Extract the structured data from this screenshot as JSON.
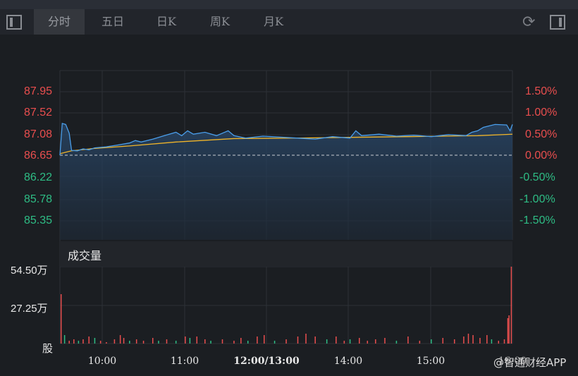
{
  "toolbar": {
    "tabs": [
      "分时",
      "五日",
      "日K",
      "周K",
      "月K"
    ],
    "active": 0,
    "left_icon": "panel-left-icon",
    "refresh_icon": "refresh-icon",
    "right_icon": "panel-right-icon"
  },
  "price_axis": {
    "labels": [
      "87.95",
      "87.52",
      "87.08",
      "86.65",
      "86.22",
      "85.78",
      "85.35"
    ],
    "pct_labels": [
      "1.50%",
      "1.00%",
      "0.50%",
      "0.00%",
      "-0.50%",
      "-1.00%",
      "-1.50%"
    ]
  },
  "volume": {
    "title": "成交量",
    "labels": [
      "54.50万",
      "27.25万"
    ],
    "unit": "股"
  },
  "time_labels": [
    "10:00",
    "11:00",
    "12:00/13:00",
    "14:00",
    "15:00",
    "16:00"
  ],
  "watermark": "@智通财经APP",
  "colors": {
    "price_line": "#4a9eea",
    "avg_line": "#f0b429",
    "up": "#e94e4e",
    "down": "#2ebd85"
  },
  "chart_data": {
    "type": "line",
    "prev_close": 86.65,
    "ylim": [
      85.2,
      88.1
    ],
    "x_minutes_range": [
      0,
      390
    ],
    "price": [
      [
        0,
        86.65
      ],
      [
        2,
        87.3
      ],
      [
        5,
        87.28
      ],
      [
        8,
        87.1
      ],
      [
        10,
        86.75
      ],
      [
        15,
        86.74
      ],
      [
        20,
        86.78
      ],
      [
        25,
        86.76
      ],
      [
        30,
        86.8
      ],
      [
        40,
        86.82
      ],
      [
        50,
        86.86
      ],
      [
        60,
        86.9
      ],
      [
        65,
        86.95
      ],
      [
        70,
        86.92
      ],
      [
        80,
        86.98
      ],
      [
        90,
        87.05
      ],
      [
        100,
        87.12
      ],
      [
        105,
        87.05
      ],
      [
        110,
        87.15
      ],
      [
        115,
        87.08
      ],
      [
        125,
        87.12
      ],
      [
        135,
        87.05
      ],
      [
        145,
        87.15
      ],
      [
        150,
        87.05
      ],
      [
        160,
        87.0
      ],
      [
        175,
        87.04
      ],
      [
        190,
        87.02
      ],
      [
        205,
        87.0
      ],
      [
        220,
        86.98
      ],
      [
        235,
        87.03
      ],
      [
        250,
        87.0
      ],
      [
        250,
        87.0
      ],
      [
        255,
        87.15
      ],
      [
        260,
        87.05
      ],
      [
        275,
        87.08
      ],
      [
        290,
        87.04
      ],
      [
        305,
        87.06
      ],
      [
        320,
        87.03
      ],
      [
        335,
        87.07
      ],
      [
        350,
        87.05
      ],
      [
        355,
        87.12
      ],
      [
        360,
        87.15
      ],
      [
        365,
        87.22
      ],
      [
        375,
        87.28
      ],
      [
        385,
        87.27
      ],
      [
        388,
        87.15
      ],
      [
        390,
        87.28
      ]
    ],
    "avg": [
      [
        0,
        86.68
      ],
      [
        10,
        86.74
      ],
      [
        30,
        86.79
      ],
      [
        60,
        86.84
      ],
      [
        100,
        86.92
      ],
      [
        150,
        86.99
      ],
      [
        200,
        87.0
      ],
      [
        300,
        87.03
      ],
      [
        360,
        87.05
      ],
      [
        390,
        87.08
      ]
    ],
    "volume_max": 54.5,
    "volume": [
      [
        1,
        35,
        1
      ],
      [
        4,
        6,
        0
      ],
      [
        8,
        2,
        1
      ],
      [
        12,
        3,
        1
      ],
      [
        16,
        2,
        0
      ],
      [
        20,
        3,
        1
      ],
      [
        25,
        5,
        1
      ],
      [
        30,
        4,
        0
      ],
      [
        35,
        2,
        1
      ],
      [
        40,
        1,
        1
      ],
      [
        47,
        3,
        1
      ],
      [
        52,
        6,
        1
      ],
      [
        55,
        4,
        1
      ],
      [
        60,
        2,
        0
      ],
      [
        66,
        3,
        1
      ],
      [
        72,
        2,
        1
      ],
      [
        80,
        4,
        1
      ],
      [
        85,
        2,
        0
      ],
      [
        92,
        3,
        1
      ],
      [
        100,
        2,
        0
      ],
      [
        108,
        5,
        1
      ],
      [
        112,
        4,
        0
      ],
      [
        118,
        5,
        1
      ],
      [
        125,
        3,
        1
      ],
      [
        130,
        2,
        0
      ],
      [
        140,
        3,
        1
      ],
      [
        150,
        2,
        1
      ],
      [
        156,
        4,
        1
      ],
      [
        162,
        2,
        0
      ],
      [
        170,
        5,
        1
      ],
      [
        176,
        6,
        1
      ],
      [
        185,
        2,
        0
      ],
      [
        195,
        3,
        1
      ],
      [
        205,
        5,
        1
      ],
      [
        212,
        7,
        1
      ],
      [
        220,
        5,
        1
      ],
      [
        230,
        3,
        0
      ],
      [
        238,
        5,
        1
      ],
      [
        245,
        2,
        1
      ],
      [
        250,
        3,
        0
      ],
      [
        258,
        4,
        1
      ],
      [
        265,
        2,
        1
      ],
      [
        272,
        3,
        1
      ],
      [
        280,
        4,
        1
      ],
      [
        290,
        2,
        0
      ],
      [
        300,
        5,
        1
      ],
      [
        310,
        2,
        1
      ],
      [
        320,
        3,
        0
      ],
      [
        330,
        4,
        1
      ],
      [
        340,
        3,
        1
      ],
      [
        348,
        5,
        1
      ],
      [
        352,
        7,
        1
      ],
      [
        356,
        6,
        1
      ],
      [
        362,
        4,
        1
      ],
      [
        368,
        6,
        1
      ],
      [
        372,
        3,
        0
      ],
      [
        378,
        2,
        1
      ],
      [
        383,
        3,
        1
      ],
      [
        386,
        18,
        1
      ],
      [
        387,
        20,
        1
      ],
      [
        389,
        54.5,
        1
      ]
    ]
  }
}
